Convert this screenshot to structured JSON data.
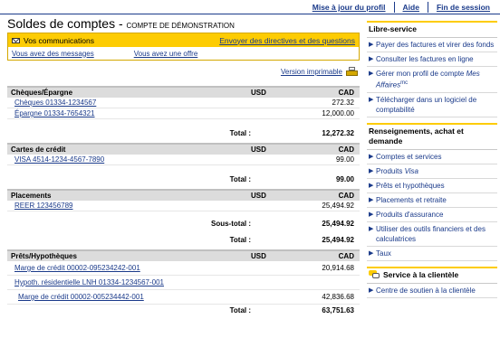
{
  "toplinks": {
    "update_profile": "Mise à jour du profil",
    "help": "Aide",
    "logout": "Fin de session"
  },
  "title": {
    "main": "Soldes de comptes - ",
    "sub": "COMPTE DE DÉMONSTRATION"
  },
  "communications": {
    "header": "Vos communications",
    "send_link": "Envoyer des directives et des questions",
    "messages_link": "Vous avez des messages",
    "offer_link": "Vous avez une offre"
  },
  "print_label": "Version imprimable",
  "columns": {
    "usd": "USD",
    "cad": "CAD"
  },
  "sections": {
    "chequing": {
      "title": "Chèques/Épargne",
      "rows": [
        {
          "name": "Chèques 01334-1234567",
          "cad": "272.32"
        },
        {
          "name": "Épargne 01334-7654321",
          "cad": "12,000.00"
        }
      ],
      "total_label": "Total :",
      "total": "12,272.32"
    },
    "credit": {
      "title": "Cartes de crédit",
      "rows": [
        {
          "name": "VISA 4514-1234-4567-7890",
          "cad": "99.00"
        }
      ],
      "total_label": "Total :",
      "total": "99.00"
    },
    "investments": {
      "title": "Placements",
      "rows": [
        {
          "name": "REER 123456789",
          "cad": "25,494.92"
        }
      ],
      "subtotal_label": "Sous-total :",
      "subtotal": "25,494.92",
      "total_label": "Total :",
      "total": "25,494.92"
    },
    "loans": {
      "title": "Prêts/Hypothèques",
      "rows": [
        {
          "name": "Marge de crédit 00002-095234242-001",
          "cad": "20,914.68"
        },
        {
          "name": "Hypoth. résidentielle LNH 01334-1234567-001",
          "cad": ""
        },
        {
          "name": "Marge de crédit 00002-005234442-001",
          "cad": "42,836.68"
        }
      ],
      "total_label": "Total :",
      "total": "63,751.63"
    }
  },
  "sidebar": {
    "self_service": {
      "title": "Libre-service",
      "items": [
        "Payer des factures et virer des fonds",
        "Consulter les factures en ligne",
        "Télécharger dans un logiciel de comptabilité"
      ],
      "profile_prefix": "Gérer mon profil de compte ",
      "profile_brand": "Mes Affaires",
      "profile_mc": "mc"
    },
    "info": {
      "title": "Renseignements, achat et demande",
      "items": [
        "Comptes et services",
        "Prêts et hypothèques",
        "Placements et retraite",
        "Produits d'assurance",
        "Utiliser des outils financiers et des calculatrices",
        "Taux"
      ],
      "visa_prefix": "Produits ",
      "visa_brand": "Visa"
    },
    "service": {
      "title": "Service à la clientèle",
      "items": [
        "Centre de soutien à la clientèle"
      ]
    }
  },
  "colors": {
    "accent_yellow": "#fdcc03",
    "link_blue": "#1a3a8a",
    "header_gray": "#dcdcdc"
  }
}
